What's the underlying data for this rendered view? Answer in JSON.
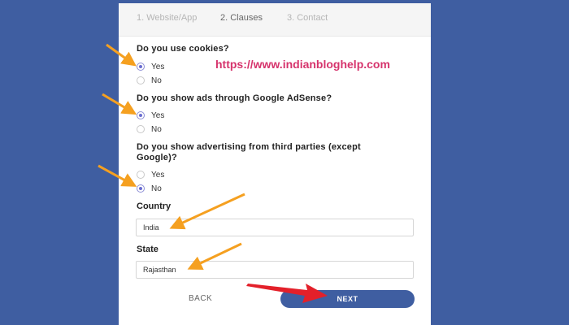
{
  "tabs": [
    {
      "label": "1. Website/App"
    },
    {
      "label": "2. Clauses"
    },
    {
      "label": "3. Contact"
    }
  ],
  "questions": {
    "cookies": {
      "label": "Do you use cookies?",
      "yes": "Yes",
      "no": "No",
      "selected": "Yes"
    },
    "adsense": {
      "label": "Do you show ads through Google AdSense?",
      "yes": "Yes",
      "no": "No",
      "selected": "Yes"
    },
    "third_party": {
      "label_line1": "Do you show advertising from third parties (except",
      "label_line2": "Google)?",
      "yes": "Yes",
      "no": "No",
      "selected": "No"
    }
  },
  "country": {
    "label": "Country",
    "value": "India"
  },
  "state": {
    "label": "State",
    "value": "Rajasthan"
  },
  "buttons": {
    "back": "BACK",
    "next": "NEXT"
  },
  "watermark": "https://www.indianbloghelp.com",
  "colors": {
    "background": "#3f5ea1",
    "accent": "#6a6dd1",
    "arrow": "#f5a020",
    "red_arrow": "#e3202a",
    "watermark": "#d6336c"
  }
}
